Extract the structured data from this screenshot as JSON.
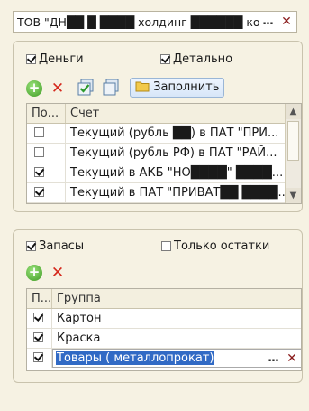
{
  "organization": {
    "value": "ТОВ \"ДН██ █ ████ холдинг ██████ компанія\"",
    "select_label": "...",
    "clear_label": "✕"
  },
  "money_group": {
    "checkbox_money": {
      "label": "Деньги",
      "checked": true
    },
    "checkbox_detail": {
      "label": "Детально",
      "checked": true
    },
    "fill_button_label": "Заполнить",
    "table": {
      "columns": [
        "По...",
        "Счет"
      ],
      "rows": [
        {
          "checked": false,
          "account": "Текущий (рубль ██) в ПАТ \"ПРИ..."
        },
        {
          "checked": false,
          "account": "Текущий (рубль РФ) в ПАТ \"РАЙ..."
        },
        {
          "checked": true,
          "account": "Текущий в АКБ \"НО████\" ████..."
        },
        {
          "checked": true,
          "account": "Текущий в ПАТ \"ПРИВАТ██ ████..."
        }
      ]
    }
  },
  "stock_group": {
    "checkbox_stock": {
      "label": "Запасы",
      "checked": true
    },
    "checkbox_only_remains": {
      "label": "Только остатки",
      "checked": false
    },
    "table": {
      "columns": [
        "П...",
        "Группа"
      ],
      "rows": [
        {
          "checked": true,
          "group": "Картон"
        },
        {
          "checked": true,
          "group": "Краска"
        },
        {
          "checked": true,
          "group": "Товары ( металлопрокат)"
        }
      ],
      "edit_select_label": "...",
      "edit_clear_label": "✕"
    }
  }
}
